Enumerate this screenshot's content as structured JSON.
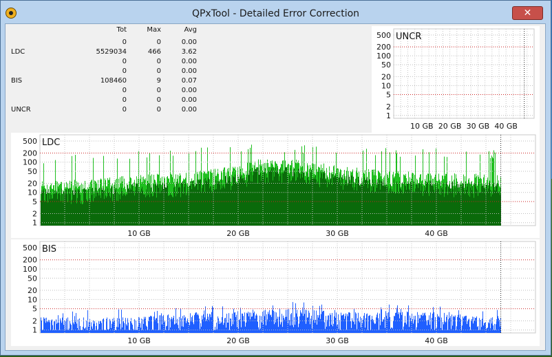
{
  "window": {
    "title": "QPxTool - Detailed Error Correction",
    "close_label": "✕"
  },
  "stats": {
    "headers": [
      "Tot",
      "Max",
      "Avg"
    ],
    "rows": [
      {
        "label": "",
        "tot": "0",
        "max": "0",
        "avg": "0.00"
      },
      {
        "label": "LDC",
        "tot": "5529034",
        "max": "466",
        "avg": "3.62"
      },
      {
        "label": "",
        "tot": "0",
        "max": "0",
        "avg": "0.00"
      },
      {
        "label": "",
        "tot": "0",
        "max": "0",
        "avg": "0.00"
      },
      {
        "label": "BIS",
        "tot": "108460",
        "max": "9",
        "avg": "0.07"
      },
      {
        "label": "",
        "tot": "0",
        "max": "0",
        "avg": "0.00"
      },
      {
        "label": "",
        "tot": "0",
        "max": "0",
        "avg": "0.00"
      },
      {
        "label": "UNCR",
        "tot": "0",
        "max": "0",
        "avg": "0.00"
      }
    ]
  },
  "chart_data": [
    {
      "type": "bar",
      "title": "UNCR",
      "y_scale": "log",
      "y_ticks": [
        "500",
        "200",
        "100",
        "50",
        "20",
        "10",
        "5",
        "2",
        "1"
      ],
      "x_ticks": [
        "10 GB",
        "20 GB",
        "30 GB",
        "40 GB"
      ],
      "x_range_gb": [
        0,
        50
      ],
      "data_end_gb": 46.5,
      "values": [],
      "grid": true
    },
    {
      "type": "bar",
      "title": "LDC",
      "y_scale": "log",
      "y_ticks": [
        "500",
        "200",
        "100",
        "50",
        "20",
        "10",
        "5",
        "2",
        "1"
      ],
      "x_ticks": [
        "10 GB",
        "20 GB",
        "30 GB",
        "40 GB"
      ],
      "x_range_gb": [
        0,
        50
      ],
      "data_end_gb": 46.5,
      "grid": true,
      "colors": {
        "bar": "#1fbf1f",
        "inner": "#0a6a0a"
      },
      "profile": {
        "x_gb": [
          0,
          5,
          10,
          15,
          20,
          22,
          25,
          30,
          35,
          40,
          46.5
        ],
        "typical": [
          20,
          20,
          30,
          35,
          60,
          100,
          100,
          60,
          40,
          35,
          30
        ],
        "peak": [
          150,
          200,
          250,
          300,
          350,
          400,
          400,
          350,
          300,
          300,
          250
        ]
      }
    },
    {
      "type": "bar",
      "title": "BIS",
      "y_scale": "log",
      "y_ticks": [
        "500",
        "200",
        "100",
        "50",
        "20",
        "10",
        "5",
        "2",
        "1"
      ],
      "x_ticks": [
        "10 GB",
        "20 GB",
        "30 GB",
        "40 GB"
      ],
      "x_range_gb": [
        0,
        50
      ],
      "data_end_gb": 46.5,
      "grid": true,
      "colors": {
        "bar": "#1f5fff"
      },
      "profile": {
        "x_gb": [
          0,
          10,
          15,
          20,
          25,
          30,
          35,
          40,
          46.5
        ],
        "typical": [
          2,
          2,
          3,
          3,
          4,
          3,
          3,
          3,
          2
        ],
        "peak": [
          5,
          5,
          6,
          7,
          9,
          8,
          7,
          6,
          5
        ]
      }
    }
  ]
}
